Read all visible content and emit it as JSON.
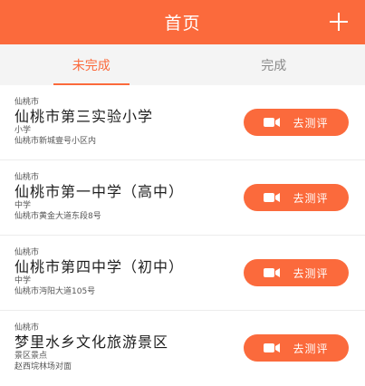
{
  "header": {
    "title": "首页",
    "add_icon": "plus-icon"
  },
  "tabs": [
    {
      "label": "未完成",
      "active": true
    },
    {
      "label": "完成",
      "active": false
    }
  ],
  "items": [
    {
      "city": "仙桃市",
      "name": "仙桃市第三实验小学",
      "type": "小学",
      "address": "仙桃市新城壹号小区内",
      "button_label": "去测评"
    },
    {
      "city": "仙桃市",
      "name": "仙桃市第一中学（高中）",
      "type": "中学",
      "address": "仙桃市黄金大道东段8号",
      "button_label": "去测评"
    },
    {
      "city": "仙桃市",
      "name": "仙桃市第四中学（初中）",
      "type": "中学",
      "address": "仙桃市沔阳大道105号",
      "button_label": "去测评"
    },
    {
      "city": "仙桃市",
      "name": "梦里水乡文化旅游景区",
      "type": "景区景点",
      "address": "赵西垸林场对面",
      "button_label": "去测评"
    }
  ],
  "colors": {
    "accent": "#fb6a3c",
    "tab_bar": "#f4f4f4",
    "text": "#1e1e1e",
    "muted": "#555555"
  },
  "icons": {
    "button": "video-camera-icon"
  }
}
